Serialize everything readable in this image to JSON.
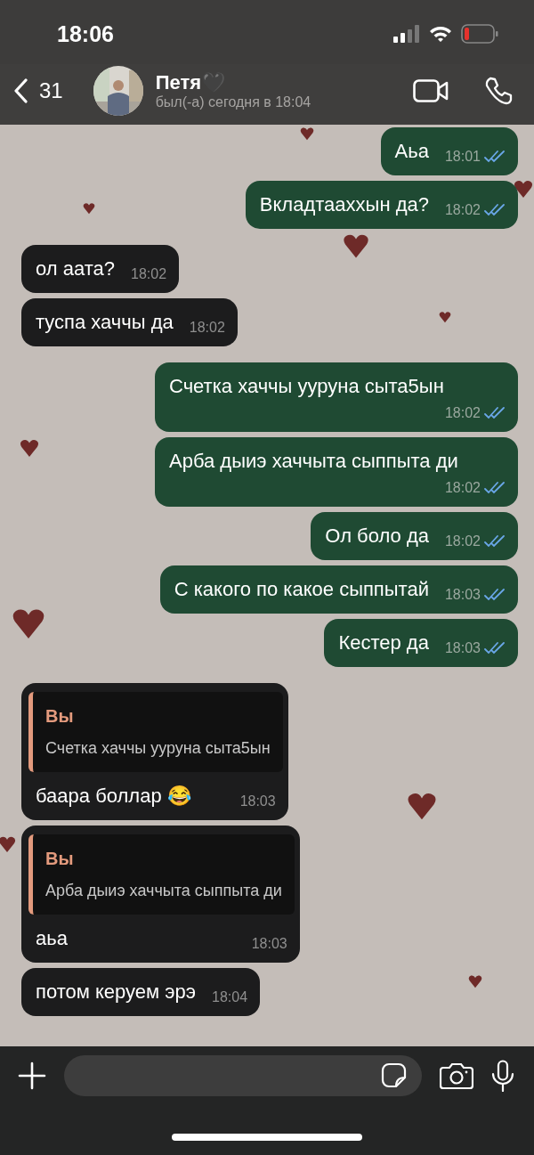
{
  "status_bar": {
    "time": "18:06"
  },
  "header": {
    "back_count": "31",
    "name": "Петя🖤",
    "last_seen": "был(-а) сегодня в 18:04"
  },
  "messages": [
    {
      "kind": "outgoing",
      "text": "Аьа",
      "time": "18:01",
      "read": true
    },
    {
      "kind": "outgoing",
      "text": "Вкладтааххын да?",
      "time": "18:02",
      "read": true
    },
    {
      "kind": "incoming",
      "text": "ол аата?",
      "time": "18:02"
    },
    {
      "kind": "incoming",
      "text": "туспа хаччы да",
      "time": "18:02"
    },
    {
      "kind": "outgoing",
      "text": "Счетка хаччы ууруна сыта5ын",
      "time": "18:02",
      "read": true
    },
    {
      "kind": "outgoing",
      "text": "Арба дыиэ хаччыта сыппыта ди",
      "time": "18:02",
      "read": true
    },
    {
      "kind": "outgoing",
      "text": "Ол боло да",
      "time": "18:02",
      "read": true
    },
    {
      "kind": "outgoing",
      "text": "С какого по какое сыппытай",
      "time": "18:03",
      "read": true
    },
    {
      "kind": "outgoing",
      "text": "Кестер да",
      "time": "18:03",
      "read": true
    },
    {
      "kind": "incoming",
      "text": "баара боллар 😂",
      "time": "18:03",
      "quote": {
        "author": "Вы",
        "text": "Счетка хаччы ууруна сыта5ын"
      }
    },
    {
      "kind": "incoming",
      "text": "аьа",
      "time": "18:03",
      "quote": {
        "author": "Вы",
        "text": "Арба дыиэ хаччыта сыппыта ди"
      }
    },
    {
      "kind": "incoming",
      "text": "потом керуем эрэ",
      "time": "18:04"
    }
  ]
}
